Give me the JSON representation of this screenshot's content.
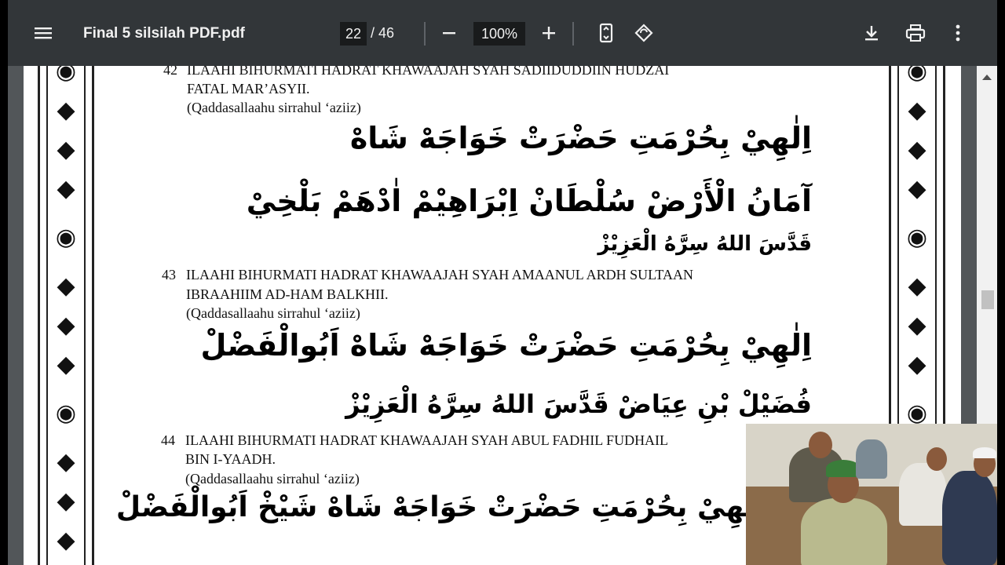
{
  "toolbar": {
    "menu_icon": "menu-icon",
    "title": "Final 5 silsilah PDF.pdf",
    "page_current": "22",
    "page_total": "/ 46",
    "zoom": "100%",
    "icons": [
      "zoom-out-icon",
      "zoom-in-icon",
      "fit-page-icon",
      "rotate-icon",
      "download-icon",
      "print-icon",
      "more-icon"
    ]
  },
  "document": {
    "entries": [
      {
        "number": "42",
        "line1": "ILAAHI BIHURMATI HADRAT KHAWAAJAH SYAH SADIIDUDDIIN HUDZAI",
        "line2": "FATAL MAR’ASYII.",
        "paren": "(Qaddasallaahu sirrahul ‘aziiz)",
        "arabic": [
          "اِلٰهِيْ بِحُرْمَتِ حَضْرَتْ خَوَاجَهْ شَاهْ",
          "آمَانُ الْأَرْضْ سُلْطَانْ اِبْرَاهِيْمْ اٰدْهَمْ بَلْخِيْ",
          "قَدَّسَ اللهُ سِرَّهُ الْعَزِيْزْ"
        ]
      },
      {
        "number": "43",
        "line1": "ILAAHI BIHURMATI HADRAT KHAWAAJAH SYAH AMAANUL ARDH SULTAAN",
        "line2": "IBRAAHIIM AD-HAM BALKHII.",
        "paren": "(Qaddasallaahu sirrahul ‘aziiz)",
        "arabic": [
          "اِلٰهِيْ بِحُرْمَتِ حَضْرَتْ خَوَاجَهْ شَاهْ اَبُوالْفَضْلْ",
          "فُضَيْلْ بْنِ عِيَاضْ قَدَّسَ اللهُ سِرَّهُ الْعَزِيْزْ"
        ]
      },
      {
        "number": "44",
        "line1": "ILAAHI BIHURMATI HADRAT KHAWAAJAH SYAH ABUL FADHIL FUDHAIL",
        "line2": "BIN I-YAADH.",
        "paren": "(Qaddasallaahu sirrahul ‘aziiz)",
        "arabic": [
          "اِلٰهِيْ بِحُرْمَتِ حَضْرَتْ خَوَاجَهْ شَاهْ شَيْخْ اَبُوالْفَضْلْ"
        ]
      }
    ]
  },
  "ornament_glyphs": [
    "◆",
    "◉",
    "◆",
    "◉"
  ],
  "colors": {
    "toolbar_bg": "#323639",
    "viewer_bg": "#525659",
    "page_bg": "#ffffff"
  }
}
